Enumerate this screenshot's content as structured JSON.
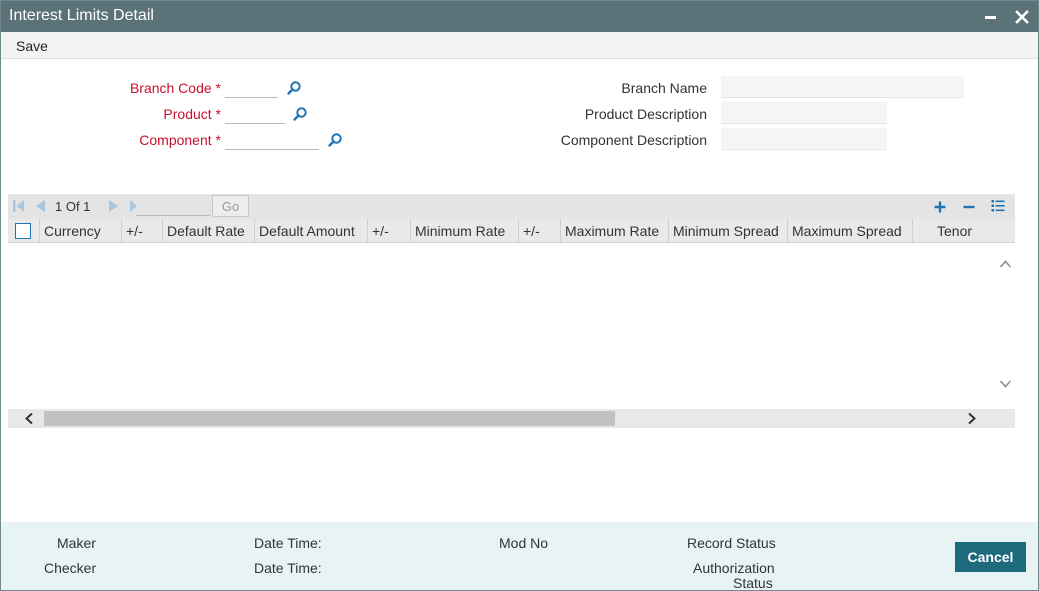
{
  "window": {
    "title": "Interest Limits Detail"
  },
  "menu": {
    "save_label": "Save"
  },
  "form": {
    "branch_code": {
      "label": "Branch Code",
      "required_mark": "*",
      "value": ""
    },
    "product": {
      "label": "Product",
      "required_mark": "*",
      "value": ""
    },
    "component": {
      "label": "Component",
      "required_mark": "*",
      "value": ""
    },
    "branch_name": {
      "label": "Branch Name",
      "value": ""
    },
    "product_description": {
      "label": "Product Description",
      "value": ""
    },
    "component_description": {
      "label": "Component Description",
      "value": ""
    }
  },
  "grid": {
    "pager_text": "1 Of 1",
    "page_input_value": "",
    "go_label": "Go",
    "columns": [
      "Currency",
      "+/-",
      "Default Rate",
      "Default Amount",
      "+/-",
      "Minimum Rate",
      "+/-",
      "Maximum Rate",
      "Minimum Spread",
      "Maximum Spread",
      "Tenor"
    ],
    "rows": []
  },
  "footer": {
    "maker": "Maker",
    "checker": "Checker",
    "date_time_1": "Date Time:",
    "date_time_2": "Date Time:",
    "mod_no": "Mod No",
    "record_status": "Record Status",
    "authorization_status_line1": "Authorization",
    "authorization_status_line2": "Status",
    "cancel_label": "Cancel"
  },
  "colors": {
    "titlebar": "#5a7278",
    "required_label": "#c8102e",
    "accent_blue": "#1f74b5",
    "cancel_button": "#1d6a7d",
    "footer_bg": "#e8f3f3"
  },
  "icons": {
    "minimize": "minimize-icon",
    "close": "close-icon",
    "lookup": "search-icon",
    "first": "first-page-icon",
    "prev": "previous-page-icon",
    "next": "next-page-icon",
    "last": "last-page-icon",
    "add": "plus-icon",
    "delete": "minus-icon",
    "single_view": "list-view-icon"
  }
}
